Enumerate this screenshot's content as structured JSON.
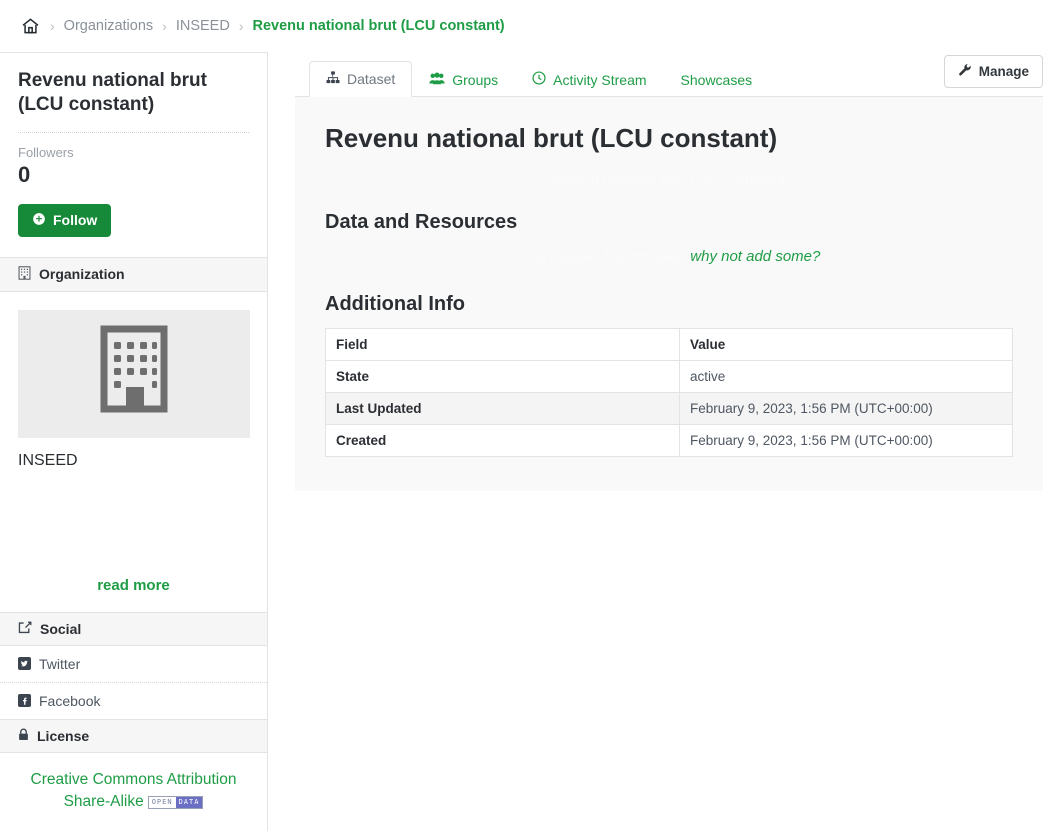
{
  "breadcrumb": {
    "home_icon": "home-icon",
    "separator": "›",
    "items": [
      {
        "label": "Organizations",
        "current": false
      },
      {
        "label": "INSEED",
        "current": false
      },
      {
        "label": "Revenu national brut (LCU constant)",
        "current": true
      }
    ]
  },
  "sidebar": {
    "dataset_title": "Revenu national brut (LCU constant)",
    "followers_label": "Followers",
    "followers_count": "0",
    "follow_button": "Follow",
    "follow_icon": "plus-circle-icon",
    "organization": {
      "heading": "Organization",
      "heading_icon": "building-icon",
      "image_icon": "building-placeholder-icon",
      "name": "INSEED",
      "read_more": "read more"
    },
    "social": {
      "heading": "Social",
      "heading_icon": "share-icon",
      "links": [
        {
          "label": "Twitter",
          "icon": "twitter-icon",
          "glyph": "t"
        },
        {
          "label": "Facebook",
          "icon": "facebook-icon",
          "glyph": "f"
        }
      ]
    },
    "license": {
      "heading": "License",
      "heading_icon": "lock-icon",
      "name": "Creative Commons Attribution Share-Alike",
      "badge_left": "OPEN",
      "badge_right": "DATA"
    }
  },
  "tabs": [
    {
      "label": "Dataset",
      "icon": "sitemap-icon",
      "active": true
    },
    {
      "label": "Groups",
      "icon": "users-icon",
      "active": false
    },
    {
      "label": "Activity Stream",
      "icon": "clock-icon",
      "active": false
    },
    {
      "label": "Showcases",
      "icon": "",
      "active": false
    }
  ],
  "manage_button": {
    "label": "Manage",
    "icon": "wrench-icon"
  },
  "main": {
    "title": "Revenu national brut (LCU constant)",
    "notes": "Revenu national brut (LCU constant)",
    "data_resources_heading": "Data and Resources",
    "empty_text": "This dataset has no data,",
    "empty_link": "why not add some?",
    "additional_info_heading": "Additional Info",
    "table": {
      "headers": [
        "Field",
        "Value"
      ],
      "rows": [
        {
          "field": "State",
          "value": "active"
        },
        {
          "field": "Last Updated",
          "value": "February 9, 2023, 1:56 PM (UTC+00:00)"
        },
        {
          "field": "Created",
          "value": "February 9, 2023, 1:56 PM (UTC+00:00)"
        }
      ]
    }
  },
  "colors": {
    "accent_green": "#1f9d46",
    "follow_green": "#178a3a",
    "panel_bg": "#f9f9f9",
    "badge_purple": "#6b6fc4"
  }
}
